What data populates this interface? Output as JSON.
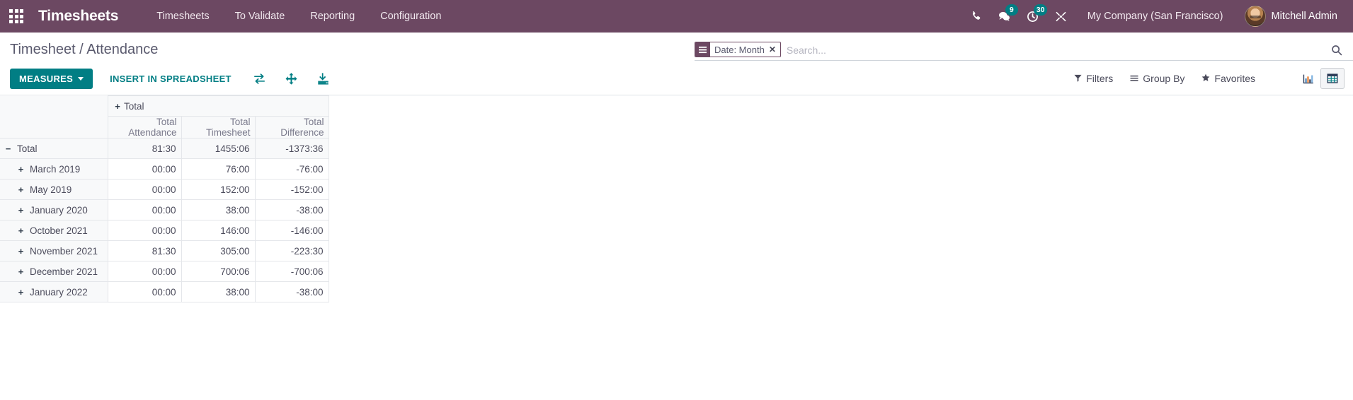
{
  "navbar": {
    "apps_icon": "apps-grid-icon",
    "brand": "Timesheets",
    "menu": [
      {
        "label": "Timesheets"
      },
      {
        "label": "To Validate"
      },
      {
        "label": "Reporting"
      },
      {
        "label": "Configuration"
      }
    ],
    "icons": [
      {
        "name": "phone-icon",
        "badge": null
      },
      {
        "name": "messages-icon",
        "badge": "9"
      },
      {
        "name": "activities-clock-icon",
        "badge": "30"
      },
      {
        "name": "developer-tools-icon",
        "badge": null
      }
    ],
    "company": "My Company (San Francisco)",
    "user": "Mitchell Admin",
    "bg_color": "#6c4862",
    "badge_color": "#017e84"
  },
  "control_panel": {
    "breadcrumb": "Timesheet / Attendance",
    "search": {
      "facet": {
        "icon": "group-by-bars-icon",
        "label": "Date: Month",
        "close": "✕"
      },
      "placeholder": "Search...",
      "value": "",
      "search_icon": "search-icon"
    },
    "buttons": {
      "measures": "MEASURES",
      "insert_spreadsheet": "INSERT IN SPREADSHEET",
      "flip_axis_icon": "flip-axis-icon",
      "expand_all_icon": "expand-all-icon",
      "download_icon": "download-xlsx-icon"
    },
    "dropdowns": [
      {
        "label": "Filters",
        "icon": "filter-funnel-icon"
      },
      {
        "label": "Group By",
        "icon": "group-by-bars-icon"
      },
      {
        "label": "Favorites",
        "icon": "star-icon"
      }
    ],
    "view_switcher": [
      {
        "name": "graph-view-button",
        "icon": "bar-chart-icon",
        "active": false
      },
      {
        "name": "pivot-view-button",
        "icon": "pivot-table-icon",
        "active": true
      }
    ],
    "accent_color": "#017e84"
  },
  "pivot": {
    "column_group_header": "Total",
    "column_group_toggle": "+",
    "measures": [
      "Total Attendance",
      "Total Timesheet",
      "Total Difference"
    ],
    "rows": [
      {
        "label": "Total",
        "toggle": "−",
        "level": 0,
        "values": [
          "81:30",
          "1455:06",
          "-1373:36"
        ]
      },
      {
        "label": "March 2019",
        "toggle": "+",
        "level": 1,
        "values": [
          "00:00",
          "76:00",
          "-76:00"
        ]
      },
      {
        "label": "May 2019",
        "toggle": "+",
        "level": 1,
        "values": [
          "00:00",
          "152:00",
          "-152:00"
        ]
      },
      {
        "label": "January 2020",
        "toggle": "+",
        "level": 1,
        "values": [
          "00:00",
          "38:00",
          "-38:00"
        ]
      },
      {
        "label": "October 2021",
        "toggle": "+",
        "level": 1,
        "values": [
          "00:00",
          "146:00",
          "-146:00"
        ]
      },
      {
        "label": "November 2021",
        "toggle": "+",
        "level": 1,
        "values": [
          "81:30",
          "305:00",
          "-223:30"
        ]
      },
      {
        "label": "December 2021",
        "toggle": "+",
        "level": 1,
        "values": [
          "00:00",
          "700:06",
          "-700:06"
        ]
      },
      {
        "label": "January 2022",
        "toggle": "+",
        "level": 1,
        "values": [
          "00:00",
          "38:00",
          "-38:00"
        ]
      }
    ]
  }
}
